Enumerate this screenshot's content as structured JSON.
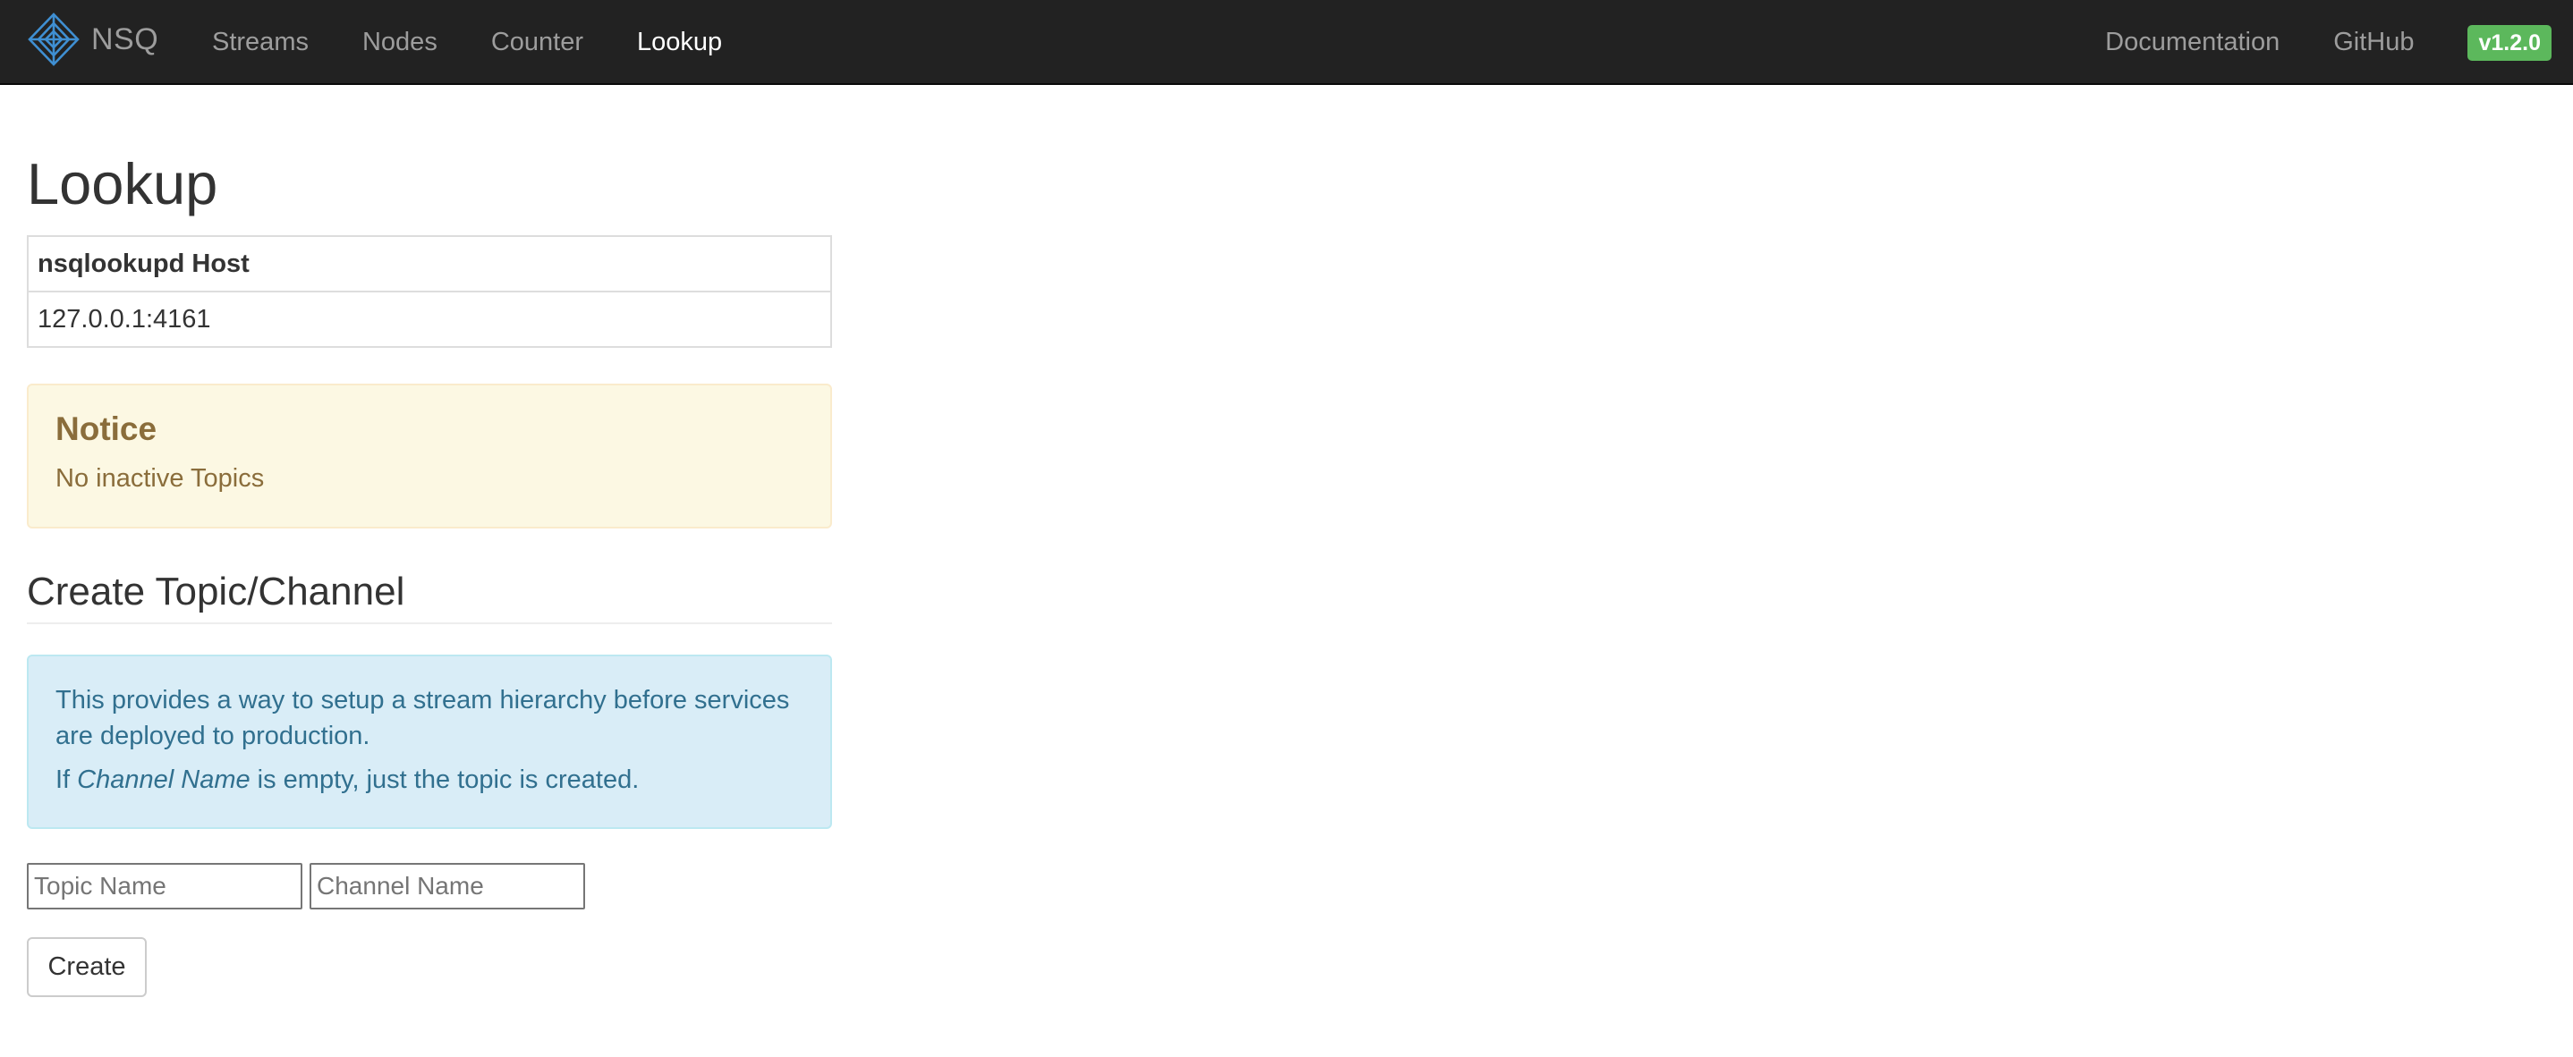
{
  "navbar": {
    "brand": "NSQ",
    "left_links": [
      {
        "label": "Streams"
      },
      {
        "label": "Nodes"
      },
      {
        "label": "Counter"
      },
      {
        "label": "Lookup",
        "active": true
      }
    ],
    "right_links": [
      {
        "label": "Documentation"
      },
      {
        "label": "GitHub"
      }
    ],
    "version": "v1.2.0"
  },
  "main": {
    "title": "Lookup",
    "host_table": {
      "header": "nsqlookupd Host",
      "value": "127.0.0.1:4161"
    },
    "notice": {
      "heading": "Notice",
      "message": "No inactive Topics"
    },
    "create_section": {
      "title": "Create Topic/Channel",
      "info_line1": "This provides a way to setup a stream hierarchy before services are deployed to production.",
      "info_line2_prefix": "If ",
      "info_line2_em": "Channel Name",
      "info_line2_suffix": " is empty, just the topic is created.",
      "topic_placeholder": "Topic Name",
      "channel_placeholder": "Channel Name",
      "button_label": "Create"
    }
  },
  "colors": {
    "navbar_bg": "#222222",
    "nav_link": "#9d9d9d",
    "nav_active": "#ffffff",
    "badge": "#5cb85c",
    "warning_bg": "#fcf8e3",
    "warning_text": "#8a6d3b",
    "info_bg": "#d9edf7",
    "info_text": "#31708f"
  }
}
